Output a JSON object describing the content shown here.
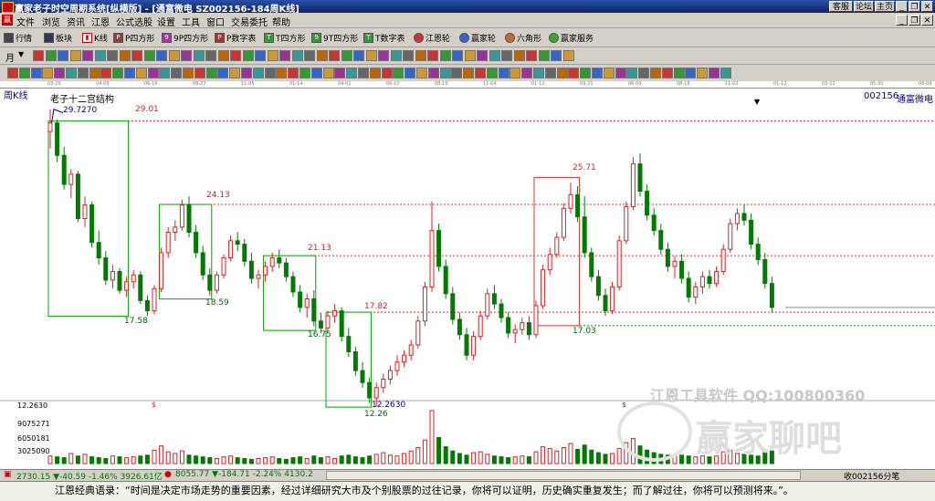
{
  "window": {
    "title": "赢家老子时空周期系统[纵横版] - [通富微电  SZ002156-184周K线]",
    "title_buttons": [
      "客服",
      "论坛",
      "主页",
      "_",
      "❐",
      "✕"
    ]
  },
  "menu": {
    "items": [
      "文件",
      "浏览",
      "资讯",
      "江恩",
      "公式选股",
      "设置",
      "工具",
      "窗口",
      "交易委托",
      "帮助"
    ],
    "doc_buttons": [
      "_",
      "❐",
      "✕"
    ]
  },
  "toolbar1": {
    "items": [
      {
        "label": "行情",
        "icon": "grid-icon"
      },
      {
        "label": "板块",
        "icon": "sector-icon"
      },
      {
        "label": "K线",
        "icon": "candle-icon"
      },
      {
        "label": "P四方形",
        "icon": "p-square-icon"
      },
      {
        "label": "9P四方形",
        "icon": "9p-square-icon"
      },
      {
        "label": "P数字表",
        "icon": "p-table-icon"
      },
      {
        "label": "T四方形",
        "icon": "t-square-icon"
      },
      {
        "label": "9T四方形",
        "icon": "9t-square-icon"
      },
      {
        "label": "T数字表",
        "icon": "t-table-icon"
      },
      {
        "label": "江恩轮",
        "icon": "gann-wheel-icon"
      },
      {
        "label": "赢家轮",
        "icon": "winner-wheel-icon"
      },
      {
        "label": "六角形",
        "icon": "hexagon-icon"
      },
      {
        "label": "赢家服务",
        "icon": "service-icon"
      }
    ]
  },
  "toolbar2": {
    "period_label": "月"
  },
  "date_strip": [
    "03-29",
    "04-09",
    "06-16",
    "08-27",
    "11-05",
    "01-14",
    "04-01",
    "06-10",
    "08-19",
    "11-04",
    "01-12",
    "03-31",
    "06-09",
    "08-18",
    "11-02",
    "01-12",
    "03-22",
    "05-31",
    "08-09"
  ],
  "chart": {
    "period_label": "周K线",
    "study_title": "老子十二宫结构",
    "stock_code": "002156",
    "stock_name": "通富微电",
    "volume_axis": [
      "12.2630",
      "9075271",
      "6050181",
      "3025090"
    ],
    "colors": {
      "up": "#d82020",
      "down": "#007a00",
      "box": "#00a000",
      "red_box": "#e03030"
    }
  },
  "chart_data": {
    "type": "candlestick",
    "title": "老子十二宫结构",
    "start_price_label": "29.7270",
    "low_price_label": "12.2630",
    "level_labels": [
      "29.01",
      "24.13",
      "21.13",
      "17.82",
      "25.71",
      "17.58",
      "18.59",
      "16.75",
      "12.26",
      "17.03"
    ],
    "ohlc": [
      [
        28.4,
        29.7,
        27.4,
        28.9
      ],
      [
        28.9,
        29.1,
        26.6,
        27.0
      ],
      [
        27.0,
        27.5,
        25.0,
        25.3
      ],
      [
        25.3,
        26.2,
        24.5,
        25.9
      ],
      [
        25.9,
        26.1,
        23.1,
        23.3
      ],
      [
        23.3,
        24.6,
        22.8,
        24.1
      ],
      [
        24.1,
        24.3,
        21.6,
        21.9
      ],
      [
        21.9,
        22.6,
        20.6,
        21.0
      ],
      [
        21.0,
        21.4,
        19.4,
        19.7
      ],
      [
        19.7,
        20.6,
        19.2,
        20.2
      ],
      [
        20.2,
        20.4,
        18.9,
        19.1
      ],
      [
        19.1,
        19.9,
        18.7,
        19.6
      ],
      [
        19.6,
        20.3,
        19.2,
        20.0
      ],
      [
        20.0,
        20.2,
        18.3,
        18.5
      ],
      [
        18.5,
        18.8,
        17.6,
        17.9
      ],
      [
        17.9,
        19.4,
        17.7,
        19.2
      ],
      [
        19.2,
        21.6,
        19.0,
        21.3
      ],
      [
        21.3,
        22.8,
        21.0,
        22.5
      ],
      [
        22.5,
        23.2,
        22.0,
        22.8
      ],
      [
        22.8,
        24.4,
        22.6,
        24.1
      ],
      [
        24.1,
        24.6,
        22.2,
        22.5
      ],
      [
        22.5,
        22.9,
        21.0,
        21.3
      ],
      [
        21.3,
        21.7,
        19.7,
        20.0
      ],
      [
        20.0,
        20.4,
        18.8,
        19.1
      ],
      [
        19.1,
        20.2,
        18.9,
        20.0
      ],
      [
        20.0,
        21.2,
        19.8,
        21.0
      ],
      [
        21.0,
        22.3,
        20.8,
        22.0
      ],
      [
        22.0,
        22.5,
        21.4,
        21.8
      ],
      [
        21.8,
        22.1,
        20.5,
        20.8
      ],
      [
        20.8,
        21.3,
        19.5,
        19.8
      ],
      [
        19.8,
        20.3,
        19.2,
        20.0
      ],
      [
        20.0,
        20.8,
        19.6,
        20.5
      ],
      [
        20.5,
        21.3,
        20.2,
        21.0
      ],
      [
        21.0,
        21.5,
        20.4,
        20.7
      ],
      [
        20.7,
        21.0,
        19.6,
        19.9
      ],
      [
        19.9,
        20.2,
        18.7,
        19.0
      ],
      [
        19.0,
        19.4,
        17.8,
        18.1
      ],
      [
        18.1,
        18.9,
        17.5,
        18.6
      ],
      [
        18.6,
        19.1,
        17.0,
        17.3
      ],
      [
        17.3,
        17.8,
        16.6,
        16.9
      ],
      [
        16.9,
        17.9,
        16.7,
        17.6
      ],
      [
        17.6,
        18.3,
        17.2,
        17.9
      ],
      [
        17.9,
        18.1,
        16.1,
        16.4
      ],
      [
        16.4,
        16.9,
        15.2,
        15.5
      ],
      [
        15.5,
        15.8,
        14.1,
        14.4
      ],
      [
        14.4,
        14.9,
        13.4,
        13.7
      ],
      [
        13.7,
        14.0,
        12.5,
        12.8
      ],
      [
        12.8,
        13.7,
        12.3,
        13.4
      ],
      [
        13.4,
        14.2,
        13.1,
        13.9
      ],
      [
        13.9,
        14.7,
        13.6,
        14.4
      ],
      [
        14.4,
        15.3,
        14.1,
        14.9
      ],
      [
        14.9,
        15.6,
        14.6,
        15.3
      ],
      [
        15.3,
        16.2,
        15.0,
        15.9
      ],
      [
        15.9,
        17.6,
        15.7,
        17.3
      ],
      [
        17.3,
        19.6,
        17.0,
        19.3
      ],
      [
        19.3,
        24.3,
        19.0,
        22.6
      ],
      [
        22.6,
        23.0,
        20.2,
        20.5
      ],
      [
        20.5,
        20.9,
        18.6,
        18.9
      ],
      [
        18.9,
        19.3,
        17.1,
        17.4
      ],
      [
        17.4,
        17.8,
        16.2,
        16.5
      ],
      [
        16.5,
        16.9,
        15.0,
        15.3
      ],
      [
        15.3,
        16.7,
        15.0,
        16.4
      ],
      [
        16.4,
        17.9,
        16.2,
        17.6
      ],
      [
        17.6,
        19.2,
        17.4,
        18.9
      ],
      [
        18.9,
        19.4,
        18.0,
        18.3
      ],
      [
        18.3,
        18.6,
        17.2,
        17.5
      ],
      [
        17.5,
        17.8,
        16.3,
        16.6
      ],
      [
        16.6,
        17.1,
        16.0,
        16.8
      ],
      [
        16.8,
        17.5,
        16.5,
        17.2
      ],
      [
        17.2,
        17.6,
        16.2,
        16.5
      ],
      [
        16.5,
        18.5,
        16.3,
        18.2
      ],
      [
        18.2,
        20.6,
        18.0,
        20.3
      ],
      [
        20.3,
        21.6,
        20.0,
        21.2
      ],
      [
        21.2,
        22.5,
        21.0,
        22.2
      ],
      [
        22.2,
        24.2,
        22.0,
        23.9
      ],
      [
        23.9,
        25.4,
        23.6,
        24.7
      ],
      [
        24.7,
        25.2,
        23.1,
        23.4
      ],
      [
        23.4,
        24.6,
        21.0,
        21.3
      ],
      [
        21.3,
        21.6,
        19.6,
        19.9
      ],
      [
        19.9,
        20.3,
        18.5,
        18.8
      ],
      [
        18.8,
        19.2,
        17.6,
        17.9
      ],
      [
        17.9,
        19.6,
        17.7,
        19.3
      ],
      [
        19.3,
        22.3,
        19.1,
        22.0
      ],
      [
        22.0,
        24.3,
        21.8,
        24.0
      ],
      [
        24.0,
        26.9,
        23.8,
        26.5
      ],
      [
        26.5,
        27.1,
        24.6,
        24.9
      ],
      [
        24.9,
        25.3,
        23.2,
        23.5
      ],
      [
        23.5,
        23.9,
        22.3,
        22.6
      ],
      [
        22.6,
        23.0,
        21.2,
        21.5
      ],
      [
        21.5,
        21.9,
        20.2,
        20.5
      ],
      [
        20.5,
        21.1,
        19.8,
        20.8
      ],
      [
        20.8,
        21.2,
        19.5,
        19.8
      ],
      [
        19.8,
        20.2,
        18.4,
        18.7
      ],
      [
        18.7,
        19.6,
        18.3,
        19.3
      ],
      [
        19.3,
        20.2,
        18.9,
        19.9
      ],
      [
        19.9,
        20.3,
        19.2,
        19.5
      ],
      [
        19.5,
        20.5,
        19.3,
        20.2
      ],
      [
        20.2,
        21.8,
        20.0,
        21.5
      ],
      [
        21.5,
        23.3,
        21.3,
        23.0
      ],
      [
        23.0,
        23.9,
        22.6,
        23.6
      ],
      [
        23.6,
        24.1,
        22.9,
        23.2
      ],
      [
        23.2,
        23.6,
        21.5,
        21.8
      ],
      [
        21.8,
        22.2,
        20.6,
        20.9
      ],
      [
        20.9,
        21.3,
        19.2,
        19.5
      ],
      [
        19.5,
        19.9,
        17.8,
        18.1
      ]
    ],
    "volume": [
      0.9,
      0.8,
      0.7,
      1.2,
      0.9,
      1.1,
      0.8,
      0.7,
      0.6,
      0.9,
      0.8,
      0.7,
      0.8,
      0.9,
      1.0,
      1.6,
      2.1,
      1.4,
      1.2,
      1.5,
      1.0,
      0.9,
      0.8,
      0.7,
      0.6,
      0.8,
      0.9,
      0.7,
      0.6,
      0.5,
      0.6,
      0.7,
      0.8,
      0.6,
      0.5,
      0.7,
      0.8,
      0.6,
      0.9,
      0.7,
      0.8,
      0.6,
      0.9,
      1.0,
      0.8,
      0.7,
      0.9,
      1.1,
      1.3,
      1.0,
      0.9,
      1.2,
      1.5,
      1.9,
      2.8,
      6.3,
      3.1,
      2.0,
      1.5,
      1.2,
      1.0,
      1.3,
      1.4,
      1.1,
      0.9,
      0.8,
      0.7,
      0.8,
      0.9,
      0.8,
      1.4,
      2.0,
      1.8,
      1.5,
      1.9,
      2.4,
      1.7,
      2.2,
      1.6,
      1.3,
      1.1,
      1.2,
      1.8,
      2.5,
      3.0,
      2.1,
      1.6,
      1.3,
      1.1,
      1.0,
      0.9,
      1.0,
      0.9,
      0.8,
      0.9,
      0.8,
      0.9,
      1.4,
      1.6,
      1.2,
      1.1,
      1.0,
      0.9,
      1.3,
      1.5
    ]
  },
  "watermark": {
    "text1": "江恩工具软件  QQ:100800360",
    "text2": "赢家聊吧"
  },
  "status": {
    "sh_index": "2730.15 ▼-40.59 -1.46% 3926.61亿",
    "sz_index": "8055.77 ▼-184.71 -2.24% 4130.2",
    "right_text": "收002156分笔"
  },
  "quote": {
    "text": "江恩经典语录：“时间是决定市场走势的重要因素，经过详细研究大市及个别股票的过往记录，你将可以证明，历史确实重复发生；而了解过往，你将可以预测将来。”。"
  }
}
